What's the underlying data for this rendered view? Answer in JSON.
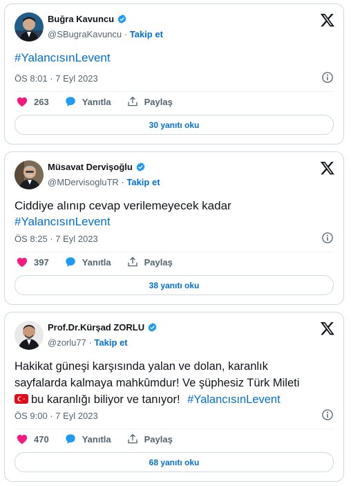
{
  "tweets": [
    {
      "name": "Buğra Kavuncu",
      "handle": "@SBugraKavuncu",
      "follow": "Takip et",
      "text_lines": [],
      "hashtag": "#YalancısınLevent",
      "time": "ÖS 8:01 · 7 Eyl 2023",
      "likes": "263",
      "reply_label": "Yanıtla",
      "share_label": "Paylaş",
      "read_replies": "30 yanıtı oku"
    },
    {
      "name": "Müsavat Dervişoğlu",
      "handle": "@MDervisogluTR",
      "follow": "Takip et",
      "text_lines": [
        "Ciddiye alınıp cevap verilemeyecek kadar"
      ],
      "hashtag": "#YalancısınLevent",
      "time": "ÖS 8:25 · 7 Eyl 2023",
      "likes": "397",
      "reply_label": "Yanıtla",
      "share_label": "Paylaş",
      "read_replies": "38 yanıtı oku"
    },
    {
      "name": "Prof.Dr.Kürşad ZORLU",
      "handle": "@zorlu77",
      "follow": "Takip et",
      "text_lines": [
        "Hakikat güneşi karşısında yalan ve dolan, karanlık",
        "sayfalarda kalmaya mahkûmdur! Ve şüphesiz Türk Mileti",
        "bu karanlığı biliyor ve tanıyor!"
      ],
      "hashtag": "#YalancısınLevent",
      "time": "ÖS 9:00 · 7 Eyl 2023",
      "likes": "470",
      "reply_label": "Yanıtla",
      "share_label": "Paylaş",
      "read_replies": "68 yanıtı oku"
    }
  ],
  "colors": {
    "link": "#006fd6",
    "like": "#f91880",
    "verified": "#1d9bf0",
    "muted": "#536471",
    "border": "#cfd9de"
  },
  "icons": [
    "verified-badge-icon",
    "x-logo-icon",
    "info-icon",
    "heart-icon",
    "comment-bubble-icon",
    "share-icon",
    "turkey-flag-icon"
  ]
}
